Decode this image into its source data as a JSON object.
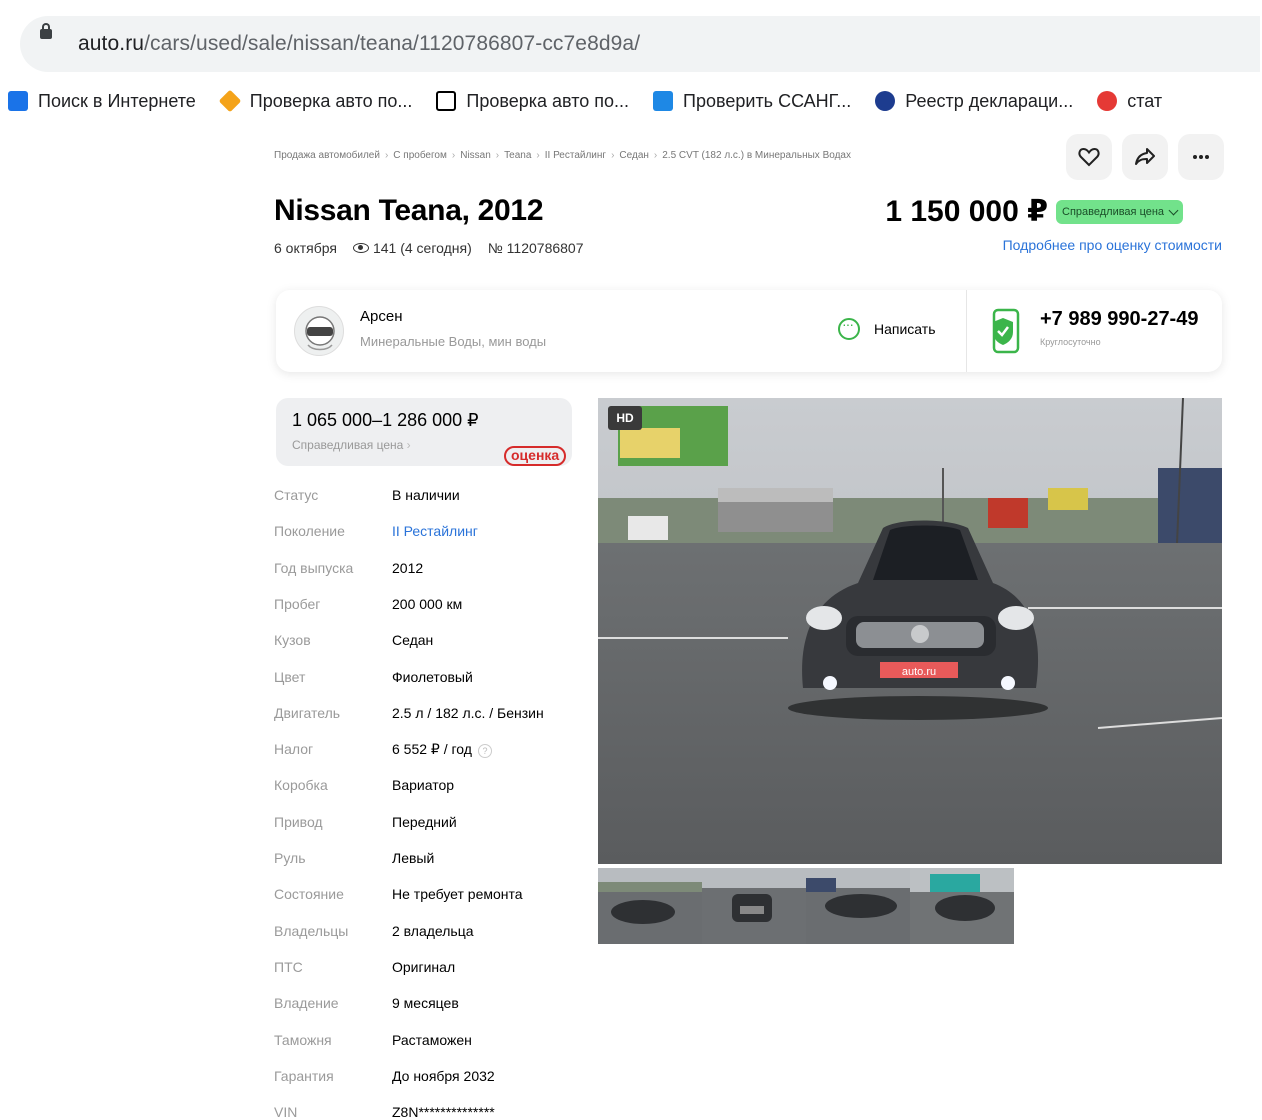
{
  "browser": {
    "url_domain": "auto.ru",
    "url_path": "/cars/used/sale/nissan/teana/1120786807-cc7e8d9a/",
    "bookmarks": [
      {
        "label": "Поиск в Интернете",
        "icon": "search-app-icon",
        "color": "#1a73e8"
      },
      {
        "label": "Проверка авто по...",
        "icon": "diamond-icon",
        "color": "#f4a31a"
      },
      {
        "label": "Проверка авто по...",
        "icon": "n-letter-icon",
        "color": "#000000"
      },
      {
        "label": "Проверить ССАНГ...",
        "icon": "car-icon",
        "color": "#1e88e5"
      },
      {
        "label": "Реестр деклараци...",
        "icon": "shield-icon",
        "color": "#1d3c8f"
      },
      {
        "label": "стат",
        "icon": "sp-icon",
        "color": "#e53935"
      }
    ]
  },
  "breadcrumbs": [
    "Продажа автомобилей",
    "С пробегом",
    "Nissan",
    "Teana",
    "II Рестайлинг",
    "Седан",
    "2.5 CVT (182 л.с.) в Минеральных Водах"
  ],
  "listing": {
    "title": "Nissan Teana, 2012",
    "date": "6 октября",
    "views": "141 (4 сегодня)",
    "number": "№ 1120786807",
    "price": "1 150 000 ₽",
    "fair_badge": "Справедливая цена",
    "fair_link": "Подробнее про оценку стоимости"
  },
  "seller": {
    "name": "Арсен",
    "location": "Минеральные Воды, мин воды",
    "write_label": "Написать",
    "phone": "+7 989 990-27-49",
    "phone_note": "Круглосуточно"
  },
  "valuation": {
    "range": "1 065 000–1 286 000 ₽",
    "label": "Справедливая цена",
    "stamp": "оценка"
  },
  "specs": [
    {
      "k": "Статус",
      "v": "В наличии"
    },
    {
      "k": "Поколение",
      "v": "II Рестайлинг",
      "link": true
    },
    {
      "k": "Год выпуска",
      "v": "2012"
    },
    {
      "k": "Пробег",
      "v": "200 000 км"
    },
    {
      "k": "Кузов",
      "v": "Седан"
    },
    {
      "k": "Цвет",
      "v": "Фиолетовый"
    },
    {
      "k": "Двигатель",
      "v": "2.5 л / 182 л.с. / Бензин"
    },
    {
      "k": "Налог",
      "v": "6 552 ₽ / год",
      "help": true
    },
    {
      "k": "Коробка",
      "v": "Вариатор"
    },
    {
      "k": "Привод",
      "v": "Передний"
    },
    {
      "k": "Руль",
      "v": "Левый"
    },
    {
      "k": "Состояние",
      "v": "Не требует ремонта"
    },
    {
      "k": "Владельцы",
      "v": "2 владельца"
    },
    {
      "k": "ПТС",
      "v": "Оригинал"
    },
    {
      "k": "Владение",
      "v": "9 месяцев"
    },
    {
      "k": "Таможня",
      "v": "Растаможен"
    },
    {
      "k": "Гарантия",
      "v": "До ноября 2032"
    },
    {
      "k": "VIN",
      "v": "Z8N**************"
    }
  ],
  "gallery": {
    "hd_label": "HD",
    "plate_text": "auto.ru"
  }
}
